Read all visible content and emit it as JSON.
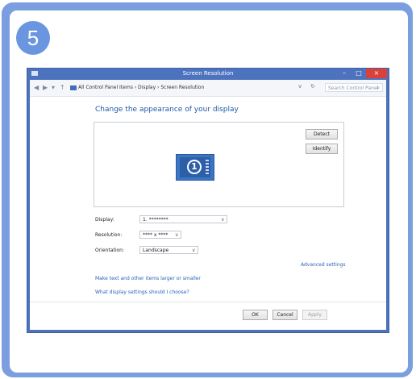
{
  "step": "5",
  "window": {
    "title": "Screen Resolution",
    "controls": {
      "minimize": "–",
      "maximize": "□",
      "close": "×"
    }
  },
  "address_bar": {
    "nav": {
      "back": "◀",
      "forward": "▶",
      "dropdown": "▾",
      "up": "↑"
    },
    "path": "All Control Panel Items  ›  Display  ›  Screen Resolution",
    "dropdown_arrow": "v",
    "refresh": "↻",
    "search_placeholder": "Search Control Panel",
    "search_icon": "⌕"
  },
  "heading": "Change the appearance of your display",
  "preview": {
    "monitor_number": "1",
    "detect_label": "Detect",
    "identify_label": "Identify"
  },
  "settings": {
    "display_label": "Display:",
    "display_value": "1. ********",
    "resolution_label": "Resolution:",
    "resolution_value": "**** x ****",
    "orientation_label": "Orientation:",
    "orientation_value": "Landscape",
    "dropdown_arrow": "v"
  },
  "links": {
    "advanced": "Advanced settings",
    "larger_text": "Make text and other items larger or smaller",
    "which_settings": "What display settings should I choose?"
  },
  "buttons": {
    "ok": "OK",
    "cancel": "Cancel",
    "apply": "Apply"
  },
  "colors": {
    "accent": "#7b9ee0",
    "window_frame": "#4d73bf",
    "close": "#d9413a",
    "link": "#2b62b8"
  },
  "icons": [
    "control-panel-icon",
    "back-icon",
    "forward-icon",
    "up-icon",
    "computer-icon",
    "refresh-icon",
    "search-icon",
    "monitor-icon"
  ]
}
